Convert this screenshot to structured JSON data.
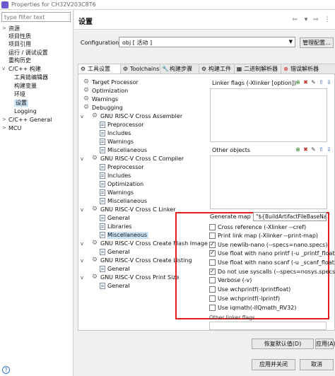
{
  "window": {
    "title": "Properties for CH32V203C8T6"
  },
  "nav": {
    "filter_placeholder": "type filter text",
    "items": [
      "资源",
      "项目性质",
      "项目引用",
      "运行 / 调试设置",
      "重构历史",
      "C/C++ 构建",
      "工具链编辑器",
      "构建变量",
      "环境",
      "设置",
      "Logging",
      "C/C++ General",
      "MCU"
    ]
  },
  "header": {
    "title": "设置"
  },
  "config": {
    "label": "Configuration:",
    "value": "obj [ 活动 ]",
    "manage_button": "管理配置..."
  },
  "tabs": [
    "工具设置",
    "Toolchains",
    "构建步骤",
    "构建工件",
    "二进制解析器",
    "错误解析器"
  ],
  "tree": [
    "Target Processor",
    "Optimization",
    "Warnings",
    "Debugging",
    "GNU RISC-V Cross Assembler",
    "Preprocessor",
    "Includes",
    "Warnings",
    "Miscellaneous",
    "GNU RISC-V Cross C Compiler",
    "Preprocessor",
    "Includes",
    "Optimization",
    "Warnings",
    "Miscellaneous",
    "GNU RISC-V Cross C Linker",
    "General",
    "Libraries",
    "Miscellaneous",
    "GNU RISC-V Cross Create Flash Image",
    "General",
    "GNU RISC-V Cross Create Listing",
    "General",
    "GNU RISC-V Cross Print Size",
    "General"
  ],
  "linker_flags": {
    "label": "Linker flags (-Xlinker [option])"
  },
  "other_objects": {
    "label": "Other objects"
  },
  "generate_map": {
    "label": "Generate map",
    "value": "\"${BuildArtifactFileBaseName"
  },
  "options": [
    {
      "label": "Cross reference (-Xlinker --cref)",
      "checked": false
    },
    {
      "label": "Print link map (-Xlinker --print-map)",
      "checked": false
    },
    {
      "label": "Use newlib-nano (--specs=nano.specs)",
      "checked": true
    },
    {
      "label": "Use float with nano printf (-u _printf_float)",
      "checked": true
    },
    {
      "label": "Use float with nano scanf (-u _scanf_float)",
      "checked": false
    },
    {
      "label": "Do not use syscalls (--specs=nosys.specs)",
      "checked": true
    },
    {
      "label": "Verbose (-v)",
      "checked": false
    },
    {
      "label": "Use wchprintf(-lprintfloat)",
      "checked": false
    },
    {
      "label": "Use wchprintf(-lprintf)",
      "checked": false
    },
    {
      "label": "Use iqmath(-lIQmath_RV32)",
      "checked": false
    }
  ],
  "other_linker_flags": {
    "label": "Other linker flags"
  },
  "buttons": {
    "restore_defaults": "恢复默认值(D)",
    "apply": "应用(A)",
    "apply_close": "应用并关闭",
    "cancel": "取消"
  }
}
